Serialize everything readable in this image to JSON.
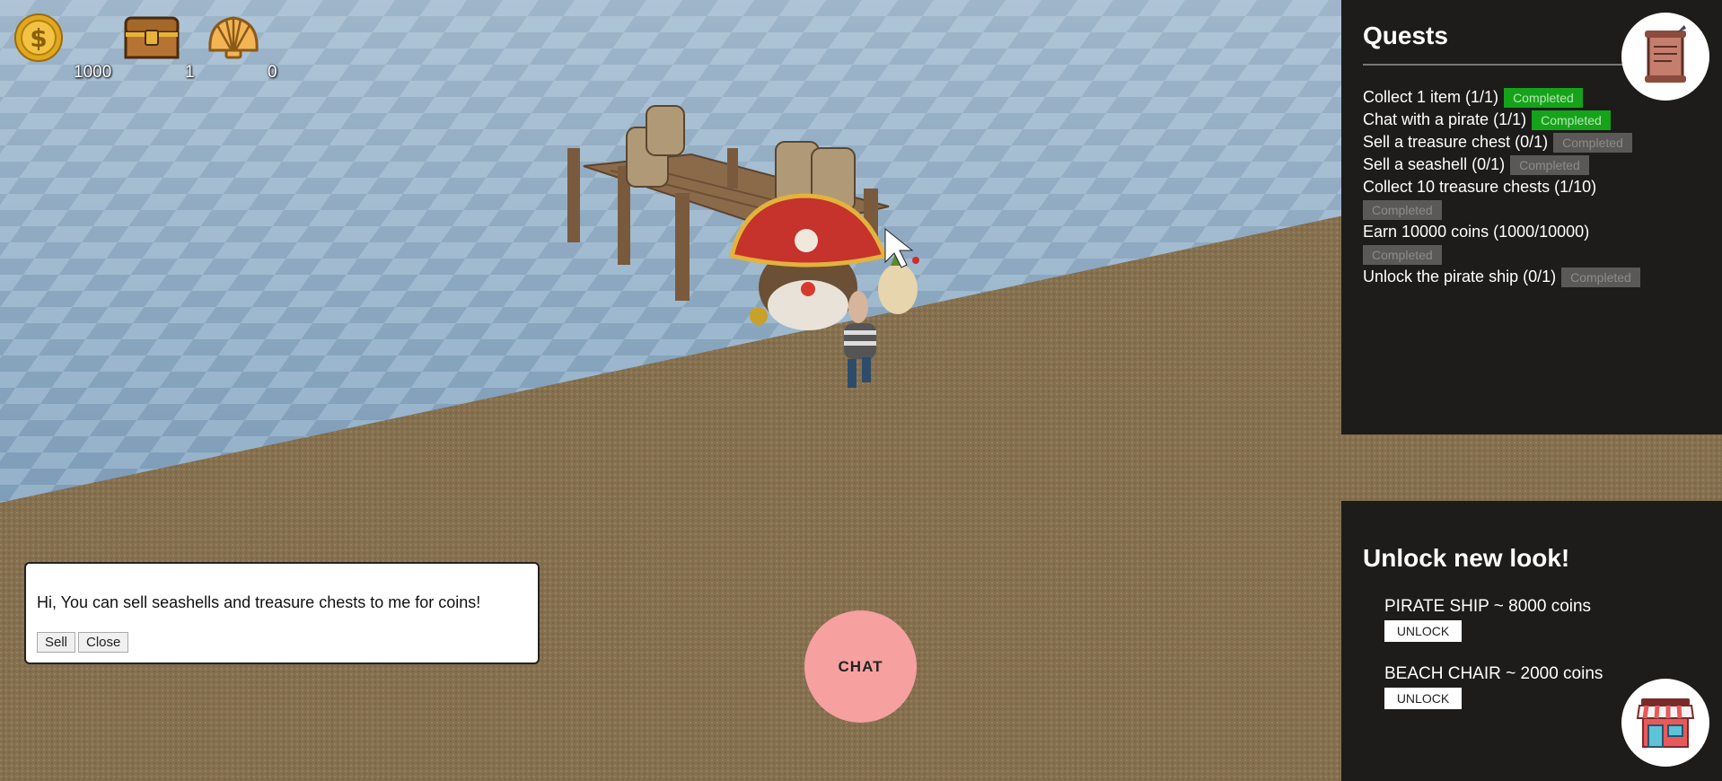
{
  "hud": {
    "coins": {
      "icon": "coin-icon",
      "count": "1000"
    },
    "chests": {
      "icon": "treasure-chest-icon",
      "count": "1"
    },
    "seashells": {
      "icon": "seashell-icon",
      "count": "0"
    }
  },
  "quests": {
    "title": "Quests",
    "icon": "quest-scroll-icon",
    "items": [
      {
        "text": "Collect 1 item (1/1)",
        "status": "Completed",
        "done": true
      },
      {
        "text": "Chat with a pirate (1/1)",
        "status": "Completed",
        "done": true
      },
      {
        "text": "Sell a treasure chest (0/1)",
        "status": "Completed",
        "done": false
      },
      {
        "text": "Sell a seashell (0/1)",
        "status": "Completed",
        "done": false
      },
      {
        "text": "Collect 10 treasure chests (1/10)",
        "status": "Completed",
        "done": false
      },
      {
        "text": "Earn 10000 coins (1000/10000)",
        "status": "Completed",
        "done": false
      },
      {
        "text": "Unlock the pirate ship (0/1)",
        "status": "Completed",
        "done": false
      }
    ]
  },
  "unlock": {
    "title": "Unlock new look!",
    "shop_icon": "shop-icon",
    "items": [
      {
        "label": "PIRATE SHIP ~ 8000 coins",
        "button": "UNLOCK"
      },
      {
        "label": "BEACH CHAIR ~ 2000 coins",
        "button": "UNLOCK"
      }
    ]
  },
  "dialog": {
    "message": "Hi, You can sell seashells and treasure chests to me for coins!",
    "sell_label": "Sell",
    "close_label": "Close"
  },
  "chat_button": {
    "label": "CHAT"
  },
  "colors": {
    "panel_bg": "#1d1c1a",
    "completed_badge": "#15a31a",
    "pending_badge": "#5a5957",
    "chat_button": "#f6a0a0"
  }
}
